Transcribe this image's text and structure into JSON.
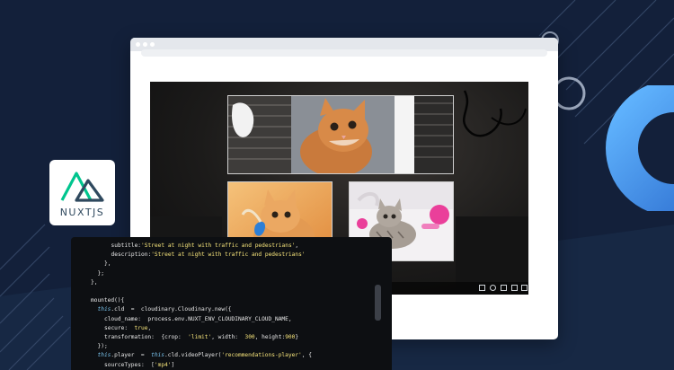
{
  "logo": {
    "text": "NUXTJS",
    "icon": "nuxt-mountain-icon"
  },
  "browser": {
    "window_dots": 3
  },
  "player": {
    "thumbnails": [
      {
        "subject": "kitten-looking-up"
      },
      {
        "subject": "kitten-with-blue-toy"
      },
      {
        "subject": "kittens-with-pink-toys"
      }
    ],
    "controls": [
      "volume-icon",
      "settings-icon",
      "captions-icon",
      "pip-icon",
      "fullscreen-icon"
    ]
  },
  "code": {
    "lines": [
      {
        "indent": 6,
        "parts": [
          {
            "t": "subtitle:"
          },
          {
            "t": "'Street at night with traffic and pedestrians'",
            "c": "s"
          },
          {
            "t": ","
          }
        ]
      },
      {
        "indent": 6,
        "parts": [
          {
            "t": "description:"
          },
          {
            "t": "'Street at night with traffic and pedestrians'",
            "c": "s"
          }
        ]
      },
      {
        "indent": 4,
        "parts": [
          {
            "t": "},"
          }
        ]
      },
      {
        "indent": 2,
        "parts": [
          {
            "t": "};"
          }
        ]
      },
      {
        "indent": 0,
        "parts": [
          {
            "t": "},"
          }
        ]
      },
      {
        "indent": 0,
        "parts": [
          {
            "t": ""
          }
        ]
      },
      {
        "indent": 0,
        "parts": [
          {
            "t": "mounted(){"
          }
        ]
      },
      {
        "indent": 2,
        "parts": [
          {
            "t": "this",
            "c": "k"
          },
          {
            "t": ".cld  =  cloudinary.Cloudinary.new({"
          }
        ]
      },
      {
        "indent": 4,
        "parts": [
          {
            "t": "cloud_name:  process.env.NUXT_ENV_CLOUDINARY_CLOUD_NAME,"
          }
        ]
      },
      {
        "indent": 4,
        "parts": [
          {
            "t": "secure:  "
          },
          {
            "t": "true",
            "c": "s"
          },
          {
            "t": ","
          }
        ]
      },
      {
        "indent": 4,
        "parts": [
          {
            "t": "transformation:  {crop:  "
          },
          {
            "t": "'limit'",
            "c": "s"
          },
          {
            "t": ", width:  "
          },
          {
            "t": "300",
            "c": "s"
          },
          {
            "t": ", height:"
          },
          {
            "t": "900",
            "c": "s"
          },
          {
            "t": "}"
          }
        ]
      },
      {
        "indent": 2,
        "parts": [
          {
            "t": "});"
          }
        ]
      },
      {
        "indent": 2,
        "parts": [
          {
            "t": "this",
            "c": "k"
          },
          {
            "t": ".player  =  "
          },
          {
            "t": "this",
            "c": "k"
          },
          {
            "t": ".cld.videoPlayer("
          },
          {
            "t": "'recommendations-player'",
            "c": "s"
          },
          {
            "t": ", {"
          }
        ]
      },
      {
        "indent": 4,
        "parts": [
          {
            "t": "sourceTypes:  ["
          },
          {
            "t": "'mp4'",
            "c": "s"
          },
          {
            "t": "]"
          }
        ]
      },
      {
        "indent": 2,
        "parts": [
          {
            "t": "}"
          }
        ]
      }
    ]
  },
  "colors": {
    "background": "#13203a",
    "nuxt_green": "#00c58e",
    "nuxt_dark": "#2f495e",
    "accent_blue": "#3c8fe6"
  }
}
